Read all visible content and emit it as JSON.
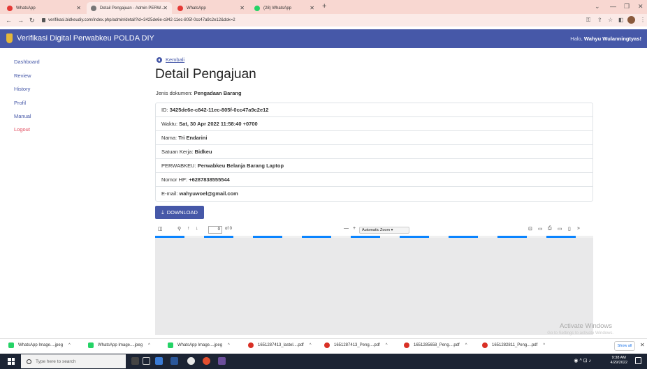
{
  "browser": {
    "tabs": [
      {
        "title": "WhatsApp",
        "color": "#e53935"
      },
      {
        "title": "Detail Pengajuan - Admin PERW...",
        "color": "#555555"
      },
      {
        "title": "WhatsApp",
        "color": "#e53935"
      },
      {
        "title": "(28) WhatsApp",
        "color": "#25d366"
      }
    ],
    "url": "verifikasi.bidkeudiy.com/index.php/admin/detail?id=3425de6e-c842-11ec-805f-0cc47a9c2e12&dok=2"
  },
  "navbar": {
    "brand": "Verifikasi Digital Perwabkeu POLDA DIY",
    "greeting_prefix": "Halo,",
    "user": "Wahyu Wulanningtyas!"
  },
  "sidebar": {
    "items": [
      "Dashboard",
      "Review",
      "History",
      "Profil",
      "Manual"
    ],
    "logout": "Logout"
  },
  "main": {
    "back_label": "Kembali",
    "title": "Detail Pengajuan",
    "jenis_label": "Jenis dokumen:",
    "jenis_value": "Pengadaan Barang",
    "details": [
      {
        "label": "ID:",
        "value": "3425de6e-c842-11ec-805f-0cc47a9c2e12"
      },
      {
        "label": "Waktu:",
        "value": "Sat, 30 Apr 2022 11:58:40 +0700"
      },
      {
        "label": "Nama:",
        "value": "Tri Endarini"
      },
      {
        "label": "Satuan Kerja:",
        "value": "Bidkeu"
      },
      {
        "label": "PERWABKEU:",
        "value": "Perwabkeu Belanja Barang Laptop"
      },
      {
        "label": "Nomor HP:",
        "value": "+6287838555544"
      },
      {
        "label": "E-mail:",
        "value": "wahyuwoel@gmail.com"
      }
    ],
    "download_label": "DOWNLOAD"
  },
  "pdf_viewer": {
    "page_value": "0",
    "page_of": "of 0",
    "zoom": "Automatic Zoom"
  },
  "watermark": {
    "line1": "Activate Windows",
    "line2": "Go to Settings to activate Windows."
  },
  "downloads": {
    "items": [
      {
        "name": "WhatsApp Image....jpeg",
        "color": "#25d366"
      },
      {
        "name": "WhatsApp Image....jpeg",
        "color": "#25d366"
      },
      {
        "name": "WhatsApp Image....jpeg",
        "color": "#25d366"
      },
      {
        "name": "1651287413_lastel....pdf",
        "color": "#d93025"
      },
      {
        "name": "1651287413_Peng....pdf",
        "color": "#d93025"
      },
      {
        "name": "1651285658_Peng....pdf",
        "color": "#d93025"
      },
      {
        "name": "1651282811_Peng....pdf",
        "color": "#d93025"
      }
    ],
    "show_all": "Show all"
  },
  "taskbar": {
    "search_placeholder": "Type here to search",
    "time": "9:38 AM",
    "date": "4/29/2022"
  }
}
